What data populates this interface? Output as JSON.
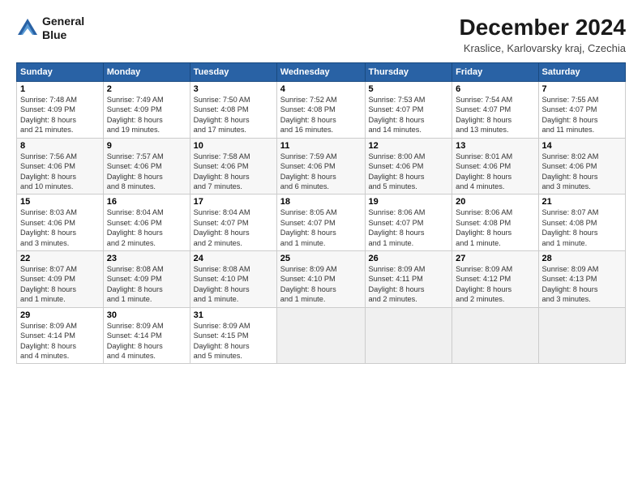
{
  "logo": {
    "line1": "General",
    "line2": "Blue"
  },
  "title": "December 2024",
  "subtitle": "Kraslice, Karlovarsky kraj, Czechia",
  "header_days": [
    "Sunday",
    "Monday",
    "Tuesday",
    "Wednesday",
    "Thursday",
    "Friday",
    "Saturday"
  ],
  "weeks": [
    [
      {
        "day": "1",
        "info": "Sunrise: 7:48 AM\nSunset: 4:09 PM\nDaylight: 8 hours\nand 21 minutes."
      },
      {
        "day": "2",
        "info": "Sunrise: 7:49 AM\nSunset: 4:09 PM\nDaylight: 8 hours\nand 19 minutes."
      },
      {
        "day": "3",
        "info": "Sunrise: 7:50 AM\nSunset: 4:08 PM\nDaylight: 8 hours\nand 17 minutes."
      },
      {
        "day": "4",
        "info": "Sunrise: 7:52 AM\nSunset: 4:08 PM\nDaylight: 8 hours\nand 16 minutes."
      },
      {
        "day": "5",
        "info": "Sunrise: 7:53 AM\nSunset: 4:07 PM\nDaylight: 8 hours\nand 14 minutes."
      },
      {
        "day": "6",
        "info": "Sunrise: 7:54 AM\nSunset: 4:07 PM\nDaylight: 8 hours\nand 13 minutes."
      },
      {
        "day": "7",
        "info": "Sunrise: 7:55 AM\nSunset: 4:07 PM\nDaylight: 8 hours\nand 11 minutes."
      }
    ],
    [
      {
        "day": "8",
        "info": "Sunrise: 7:56 AM\nSunset: 4:06 PM\nDaylight: 8 hours\nand 10 minutes."
      },
      {
        "day": "9",
        "info": "Sunrise: 7:57 AM\nSunset: 4:06 PM\nDaylight: 8 hours\nand 8 minutes."
      },
      {
        "day": "10",
        "info": "Sunrise: 7:58 AM\nSunset: 4:06 PM\nDaylight: 8 hours\nand 7 minutes."
      },
      {
        "day": "11",
        "info": "Sunrise: 7:59 AM\nSunset: 4:06 PM\nDaylight: 8 hours\nand 6 minutes."
      },
      {
        "day": "12",
        "info": "Sunrise: 8:00 AM\nSunset: 4:06 PM\nDaylight: 8 hours\nand 5 minutes."
      },
      {
        "day": "13",
        "info": "Sunrise: 8:01 AM\nSunset: 4:06 PM\nDaylight: 8 hours\nand 4 minutes."
      },
      {
        "day": "14",
        "info": "Sunrise: 8:02 AM\nSunset: 4:06 PM\nDaylight: 8 hours\nand 3 minutes."
      }
    ],
    [
      {
        "day": "15",
        "info": "Sunrise: 8:03 AM\nSunset: 4:06 PM\nDaylight: 8 hours\nand 3 minutes."
      },
      {
        "day": "16",
        "info": "Sunrise: 8:04 AM\nSunset: 4:06 PM\nDaylight: 8 hours\nand 2 minutes."
      },
      {
        "day": "17",
        "info": "Sunrise: 8:04 AM\nSunset: 4:07 PM\nDaylight: 8 hours\nand 2 minutes."
      },
      {
        "day": "18",
        "info": "Sunrise: 8:05 AM\nSunset: 4:07 PM\nDaylight: 8 hours\nand 1 minute."
      },
      {
        "day": "19",
        "info": "Sunrise: 8:06 AM\nSunset: 4:07 PM\nDaylight: 8 hours\nand 1 minute."
      },
      {
        "day": "20",
        "info": "Sunrise: 8:06 AM\nSunset: 4:08 PM\nDaylight: 8 hours\nand 1 minute."
      },
      {
        "day": "21",
        "info": "Sunrise: 8:07 AM\nSunset: 4:08 PM\nDaylight: 8 hours\nand 1 minute."
      }
    ],
    [
      {
        "day": "22",
        "info": "Sunrise: 8:07 AM\nSunset: 4:09 PM\nDaylight: 8 hours\nand 1 minute."
      },
      {
        "day": "23",
        "info": "Sunrise: 8:08 AM\nSunset: 4:09 PM\nDaylight: 8 hours\nand 1 minute."
      },
      {
        "day": "24",
        "info": "Sunrise: 8:08 AM\nSunset: 4:10 PM\nDaylight: 8 hours\nand 1 minute."
      },
      {
        "day": "25",
        "info": "Sunrise: 8:09 AM\nSunset: 4:10 PM\nDaylight: 8 hours\nand 1 minute."
      },
      {
        "day": "26",
        "info": "Sunrise: 8:09 AM\nSunset: 4:11 PM\nDaylight: 8 hours\nand 2 minutes."
      },
      {
        "day": "27",
        "info": "Sunrise: 8:09 AM\nSunset: 4:12 PM\nDaylight: 8 hours\nand 2 minutes."
      },
      {
        "day": "28",
        "info": "Sunrise: 8:09 AM\nSunset: 4:13 PM\nDaylight: 8 hours\nand 3 minutes."
      }
    ],
    [
      {
        "day": "29",
        "info": "Sunrise: 8:09 AM\nSunset: 4:14 PM\nDaylight: 8 hours\nand 4 minutes."
      },
      {
        "day": "30",
        "info": "Sunrise: 8:09 AM\nSunset: 4:14 PM\nDaylight: 8 hours\nand 4 minutes."
      },
      {
        "day": "31",
        "info": "Sunrise: 8:09 AM\nSunset: 4:15 PM\nDaylight: 8 hours\nand 5 minutes."
      },
      {
        "day": "",
        "info": ""
      },
      {
        "day": "",
        "info": ""
      },
      {
        "day": "",
        "info": ""
      },
      {
        "day": "",
        "info": ""
      }
    ]
  ]
}
